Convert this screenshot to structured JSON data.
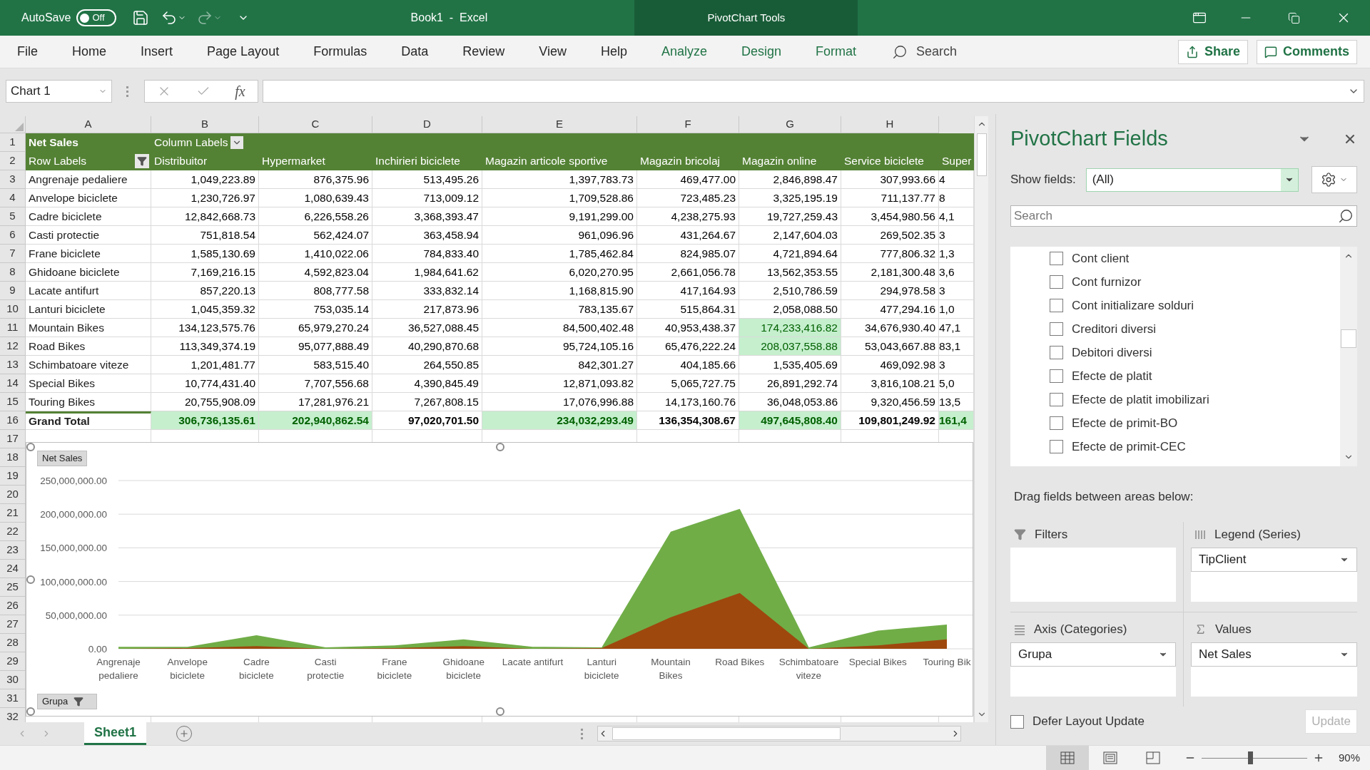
{
  "title_bar": {
    "autosave_label": "AutoSave",
    "autosave_state": "Off",
    "autosave_on": false,
    "document_title": "Book1  -  Excel",
    "context_title": "PivotChart Tools"
  },
  "ribbon_tabs": [
    {
      "label": "File",
      "contextual": false
    },
    {
      "label": "Home",
      "contextual": false
    },
    {
      "label": "Insert",
      "contextual": false
    },
    {
      "label": "Page Layout",
      "contextual": false
    },
    {
      "label": "Formulas",
      "contextual": false
    },
    {
      "label": "Data",
      "contextual": false
    },
    {
      "label": "Review",
      "contextual": false
    },
    {
      "label": "View",
      "contextual": false
    },
    {
      "label": "Help",
      "contextual": false
    },
    {
      "label": "Analyze",
      "contextual": true
    },
    {
      "label": "Design",
      "contextual": true
    },
    {
      "label": "Format",
      "contextual": true
    }
  ],
  "tell_me": {
    "placeholder": "Search"
  },
  "share_button": "Share",
  "comments_button": "Comments",
  "name_box": {
    "value": "Chart 1"
  },
  "formula_bar": {
    "function_label": "fx"
  },
  "column_headers": [
    "A",
    "B",
    "C",
    "D",
    "E",
    "F",
    "G",
    "H"
  ],
  "row_numbers": [
    "1",
    "2",
    "3",
    "4",
    "5",
    "6",
    "7",
    "8",
    "9",
    "10",
    "11",
    "12",
    "13",
    "14",
    "15",
    "16",
    "17",
    "18",
    "19",
    "20",
    "21",
    "22",
    "23",
    "24",
    "25",
    "26",
    "27",
    "28",
    "29",
    "30",
    "31",
    "32"
  ],
  "pivot_table": {
    "title": "Net Sales",
    "column_labels": "Column Labels",
    "row_labels": "Row Labels",
    "columns": [
      "Distribuitor",
      "Hypermarket",
      "Inchirieri biciclete",
      "Magazin articole sportive",
      "Magazin bricolaj",
      "Magazin online",
      "Service biciclete",
      "Super"
    ],
    "rows": [
      {
        "label": "Angrenaje pedaliere",
        "cells": [
          {
            "text": "1,049,223.89",
            "highlighted": false
          },
          {
            "text": "876,375.96",
            "highlighted": false
          },
          {
            "text": "513,495.26",
            "highlighted": false
          },
          {
            "text": "1,397,783.73",
            "highlighted": false
          },
          {
            "text": "469,477.00",
            "highlighted": false
          },
          {
            "text": "2,846,898.47",
            "highlighted": false
          },
          {
            "text": "307,993.66",
            "highlighted": false
          },
          {
            "text": "4",
            "highlighted": false
          }
        ]
      },
      {
        "label": "Anvelope biciclete",
        "cells": [
          {
            "text": "1,230,726.97",
            "highlighted": false
          },
          {
            "text": "1,080,639.43",
            "highlighted": false
          },
          {
            "text": "713,009.12",
            "highlighted": false
          },
          {
            "text": "1,709,528.86",
            "highlighted": false
          },
          {
            "text": "723,485.23",
            "highlighted": false
          },
          {
            "text": "3,325,195.19",
            "highlighted": false
          },
          {
            "text": "711,137.77",
            "highlighted": false
          },
          {
            "text": "8",
            "highlighted": false
          }
        ]
      },
      {
        "label": "Cadre biciclete",
        "cells": [
          {
            "text": "12,842,668.73",
            "highlighted": false
          },
          {
            "text": "6,226,558.26",
            "highlighted": false
          },
          {
            "text": "3,368,393.47",
            "highlighted": false
          },
          {
            "text": "9,191,299.00",
            "highlighted": false
          },
          {
            "text": "4,238,275.93",
            "highlighted": false
          },
          {
            "text": "19,727,259.43",
            "highlighted": false
          },
          {
            "text": "3,454,980.56",
            "highlighted": false
          },
          {
            "text": "4,1",
            "highlighted": false
          }
        ]
      },
      {
        "label": "Casti protectie",
        "cells": [
          {
            "text": "751,818.54",
            "highlighted": false
          },
          {
            "text": "562,424.07",
            "highlighted": false
          },
          {
            "text": "363,458.94",
            "highlighted": false
          },
          {
            "text": "961,096.96",
            "highlighted": false
          },
          {
            "text": "431,264.67",
            "highlighted": false
          },
          {
            "text": "2,147,604.03",
            "highlighted": false
          },
          {
            "text": "269,502.35",
            "highlighted": false
          },
          {
            "text": "3",
            "highlighted": false
          }
        ]
      },
      {
        "label": "Frane biciclete",
        "cells": [
          {
            "text": "1,585,130.69",
            "highlighted": false
          },
          {
            "text": "1,410,022.06",
            "highlighted": false
          },
          {
            "text": "784,833.40",
            "highlighted": false
          },
          {
            "text": "1,785,462.84",
            "highlighted": false
          },
          {
            "text": "824,985.07",
            "highlighted": false
          },
          {
            "text": "4,721,894.64",
            "highlighted": false
          },
          {
            "text": "777,806.32",
            "highlighted": false
          },
          {
            "text": "1,3",
            "highlighted": false
          }
        ]
      },
      {
        "label": "Ghidoane biciclete",
        "cells": [
          {
            "text": "7,169,216.15",
            "highlighted": false
          },
          {
            "text": "4,592,823.04",
            "highlighted": false
          },
          {
            "text": "1,984,641.62",
            "highlighted": false
          },
          {
            "text": "6,020,270.95",
            "highlighted": false
          },
          {
            "text": "2,661,056.78",
            "highlighted": false
          },
          {
            "text": "13,562,353.55",
            "highlighted": false
          },
          {
            "text": "2,181,300.48",
            "highlighted": false
          },
          {
            "text": "3,6",
            "highlighted": false
          }
        ]
      },
      {
        "label": "Lacate antifurt",
        "cells": [
          {
            "text": "857,220.13",
            "highlighted": false
          },
          {
            "text": "808,777.58",
            "highlighted": false
          },
          {
            "text": "333,832.14",
            "highlighted": false
          },
          {
            "text": "1,168,815.90",
            "highlighted": false
          },
          {
            "text": "417,164.93",
            "highlighted": false
          },
          {
            "text": "2,510,786.59",
            "highlighted": false
          },
          {
            "text": "294,978.58",
            "highlighted": false
          },
          {
            "text": "3",
            "highlighted": false
          }
        ]
      },
      {
        "label": "Lanturi biciclete",
        "cells": [
          {
            "text": "1,045,359.32",
            "highlighted": false
          },
          {
            "text": "753,035.14",
            "highlighted": false
          },
          {
            "text": "217,873.96",
            "highlighted": false
          },
          {
            "text": "783,135.67",
            "highlighted": false
          },
          {
            "text": "515,864.31",
            "highlighted": false
          },
          {
            "text": "2,058,088.50",
            "highlighted": false
          },
          {
            "text": "477,294.16",
            "highlighted": false
          },
          {
            "text": "1,0",
            "highlighted": false
          }
        ]
      },
      {
        "label": "Mountain Bikes",
        "cells": [
          {
            "text": "134,123,575.76",
            "highlighted": false
          },
          {
            "text": "65,979,270.24",
            "highlighted": false
          },
          {
            "text": "36,527,088.45",
            "highlighted": false
          },
          {
            "text": "84,500,402.48",
            "highlighted": false
          },
          {
            "text": "40,953,438.37",
            "highlighted": false
          },
          {
            "text": "174,233,416.82",
            "highlighted": true
          },
          {
            "text": "34,676,930.40",
            "highlighted": false
          },
          {
            "text": "47,1",
            "highlighted": false
          }
        ]
      },
      {
        "label": "Road Bikes",
        "cells": [
          {
            "text": "113,349,374.19",
            "highlighted": false
          },
          {
            "text": "95,077,888.49",
            "highlighted": false
          },
          {
            "text": "40,290,870.68",
            "highlighted": false
          },
          {
            "text": "95,724,105.16",
            "highlighted": false
          },
          {
            "text": "65,476,222.24",
            "highlighted": false
          },
          {
            "text": "208,037,558.88",
            "highlighted": true
          },
          {
            "text": "53,043,667.88",
            "highlighted": false
          },
          {
            "text": "83,1",
            "highlighted": false
          }
        ]
      },
      {
        "label": "Schimbatoare viteze",
        "cells": [
          {
            "text": "1,201,481.77",
            "highlighted": false
          },
          {
            "text": "583,515.40",
            "highlighted": false
          },
          {
            "text": "264,550.85",
            "highlighted": false
          },
          {
            "text": "842,301.27",
            "highlighted": false
          },
          {
            "text": "404,185.66",
            "highlighted": false
          },
          {
            "text": "1,535,405.69",
            "highlighted": false
          },
          {
            "text": "469,092.98",
            "highlighted": false
          },
          {
            "text": "3",
            "highlighted": false
          }
        ]
      },
      {
        "label": "Special Bikes",
        "cells": [
          {
            "text": "10,774,431.40",
            "highlighted": false
          },
          {
            "text": "7,707,556.68",
            "highlighted": false
          },
          {
            "text": "4,390,845.49",
            "highlighted": false
          },
          {
            "text": "12,871,093.82",
            "highlighted": false
          },
          {
            "text": "5,065,727.75",
            "highlighted": false
          },
          {
            "text": "26,891,292.74",
            "highlighted": false
          },
          {
            "text": "3,816,108.21",
            "highlighted": false
          },
          {
            "text": "5,0",
            "highlighted": false
          }
        ]
      },
      {
        "label": "Touring Bikes",
        "cells": [
          {
            "text": "20,755,908.09",
            "highlighted": false
          },
          {
            "text": "17,281,976.21",
            "highlighted": false
          },
          {
            "text": "7,267,808.15",
            "highlighted": false
          },
          {
            "text": "17,076,996.88",
            "highlighted": false
          },
          {
            "text": "14,173,160.76",
            "highlighted": false
          },
          {
            "text": "36,048,053.86",
            "highlighted": false
          },
          {
            "text": "9,320,456.59",
            "highlighted": false
          },
          {
            "text": "13,5",
            "highlighted": false
          }
        ]
      }
    ],
    "grand_total": {
      "label": "Grand Total",
      "cells": [
        {
          "text": "306,736,135.61",
          "highlighted": true
        },
        {
          "text": "202,940,862.54",
          "highlighted": true
        },
        {
          "text": "97,020,701.50",
          "highlighted": false
        },
        {
          "text": "234,032,293.49",
          "highlighted": true
        },
        {
          "text": "136,354,308.67",
          "highlighted": false
        },
        {
          "text": "497,645,808.40",
          "highlighted": true
        },
        {
          "text": "109,801,249.92",
          "highlighted": false
        },
        {
          "text": "161,4",
          "highlighted": true
        }
      ]
    }
  },
  "chart": {
    "value_button": "Net Sales",
    "axis_button": "Grupa",
    "chart_data": {
      "type": "area",
      "categories": [
        "Angrenaje pedaliere",
        "Anvelope biciclete",
        "Cadre biciclete",
        "Casti protectie",
        "Frane biciclete",
        "Ghidoane biciclete",
        "Lacate antifurt",
        "Lanturi biciclete",
        "Mountain Bikes",
        "Road Bikes",
        "Schimbatoare viteze",
        "Special Bikes",
        "Touring Bik"
      ],
      "series": [
        {
          "color": "#70ad47",
          "values": [
            3000000,
            3000000,
            20000000,
            2000000,
            5000000,
            14000000,
            3000000,
            2000000,
            174000000,
            208000000,
            2000000,
            27000000,
            36000000
          ]
        },
        {
          "color": "#9e480e",
          "values": [
            0,
            1000000,
            4000000,
            0,
            1000000,
            4000000,
            0,
            1000000,
            47000000,
            83000000,
            0,
            5000000,
            14000000
          ]
        }
      ],
      "ylim": [
        0,
        250000000
      ],
      "grid": true,
      "yticks": [
        {
          "value": 0,
          "label": "0.00"
        },
        {
          "value": 50000000,
          "label": "50,000,000.00"
        },
        {
          "value": 100000000,
          "label": "100,000,000.00"
        },
        {
          "value": 150000000,
          "label": "150,000,000.00"
        },
        {
          "value": 200000000,
          "label": "200,000,000.00"
        },
        {
          "value": 250000000,
          "label": "250,000,000.00"
        }
      ]
    }
  },
  "sheet_tabs": [
    {
      "label": "Sheet1",
      "selected": true
    }
  ],
  "pane": {
    "title": "PivotChart Fields",
    "show_fields_label": "Show fields:",
    "show_fields_value": "(All)",
    "search": {
      "placeholder": "Search"
    },
    "fields": [
      {
        "label": "Cont client",
        "checked": false
      },
      {
        "label": "Cont furnizor",
        "checked": false
      },
      {
        "label": "Cont initializare solduri",
        "checked": false
      },
      {
        "label": "Creditori diversi",
        "checked": false
      },
      {
        "label": "Debitori diversi",
        "checked": false
      },
      {
        "label": "Efecte de platit",
        "checked": false
      },
      {
        "label": "Efecte de platit imobilizari",
        "checked": false
      },
      {
        "label": "Efecte de primit-BO",
        "checked": false
      },
      {
        "label": "Efecte de primit-CEC",
        "checked": false
      }
    ],
    "areas_hint": "Drag fields between areas below:",
    "areas": [
      {
        "kind": "filters",
        "label": "Filters"
      },
      {
        "kind": "legend",
        "label": "Legend (Series)",
        "fields": [
          "TipClient"
        ]
      },
      {
        "kind": "axis",
        "label": "Axis (Categories)",
        "fields": [
          "Grupa"
        ]
      },
      {
        "kind": "values",
        "label": "Values",
        "fields": [
          "Net Sales"
        ]
      }
    ],
    "defer": {
      "label": "Defer Layout Update",
      "checked": false
    },
    "update_button": {
      "label": "Update",
      "disabled": true
    }
  },
  "status_bar": {
    "view_buttons": [
      {
        "kind": "normal",
        "selected": true
      },
      {
        "kind": "page_layout",
        "selected": false
      },
      {
        "kind": "page_break",
        "selected": false
      }
    ],
    "zoom": {
      "level": 0.46,
      "label": "90%"
    }
  }
}
